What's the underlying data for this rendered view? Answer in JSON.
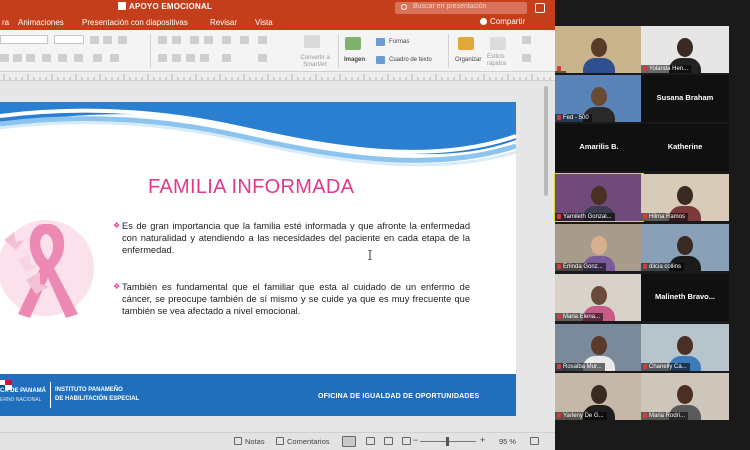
{
  "window": {
    "doc_title": "APOYO EMOCIONAL",
    "search_placeholder": "Buscar en presentación",
    "share_label": "Compartir"
  },
  "menu": [
    {
      "label": "ra"
    },
    {
      "label": "Animaciones"
    },
    {
      "label": "Presentación con diapositivas"
    },
    {
      "label": "Revisar"
    },
    {
      "label": "Vista"
    }
  ],
  "ribbon": {
    "convert_smartart": "Convertir a SmartArt",
    "image": "Imagen",
    "shapes": "Formas",
    "textbox": "Cuadro de texto",
    "organize": "Organizar",
    "quick_styles": "Estilos rápidos"
  },
  "slide": {
    "title": "FAMILIA INFORMADA",
    "bullet_glyph": "❖",
    "paragraphs": [
      "Es de gran importancia que la familia esté informada y que afronte la enfermedad con naturalidad y atendiendo a las necesidades del paciente en cada etapa de la enfermedad.",
      "También es fundamental que el familiar que esta al cuidado de un enfermo de cáncer, se preocupe también de sí mismo y se cuide ya que es muy frecuente que también se vea afectado a nivel emocional."
    ],
    "footer": {
      "gov_line": "CA DE PANAMÁ",
      "gov_sub": "ERNO NACIONAL",
      "institute_line1": "INSTITUTO PANAMEÑO",
      "institute_line2": "DE HABILITACIÓN ESPECIAL",
      "office": "OFICINA DE IGUALDAD DE OPORTUNIDADES"
    }
  },
  "status": {
    "notes": "Notas",
    "comments": "Comentarios",
    "zoom": "95 %"
  },
  "participants": [
    {
      "name": "",
      "has_video": true,
      "muted": true
    },
    {
      "name": "Yolanda Hen...",
      "has_video": true,
      "muted": true
    },
    {
      "name": "Fed - 500",
      "has_video": true,
      "muted": true
    },
    {
      "name": "Susana Braham",
      "has_video": false,
      "muted": false
    },
    {
      "name": "Amarilis B.",
      "has_video": false,
      "muted": false
    },
    {
      "name": "Katherine",
      "has_video": false,
      "muted": false
    },
    {
      "name": "Yamileth Gonzal...",
      "has_video": true,
      "muted": true,
      "active": true
    },
    {
      "name": "Hilma Ramos",
      "has_video": true,
      "muted": true
    },
    {
      "name": "Erlinda Gonz...",
      "has_video": true,
      "muted": true
    },
    {
      "name": "dilcia collins",
      "has_video": true,
      "muted": true
    },
    {
      "name": "Maria Elena...",
      "has_video": true,
      "muted": true
    },
    {
      "name": "Malineth Bravo...",
      "has_video": false,
      "muted": false
    },
    {
      "name": "Rosalba Mur...",
      "has_video": true,
      "muted": true
    },
    {
      "name": "Chanelly Ca...",
      "has_video": true,
      "muted": true
    },
    {
      "name": "Yarleny De G...",
      "has_video": true,
      "muted": true
    },
    {
      "name": "Maria Rodri...",
      "has_video": true,
      "muted": true
    }
  ]
}
